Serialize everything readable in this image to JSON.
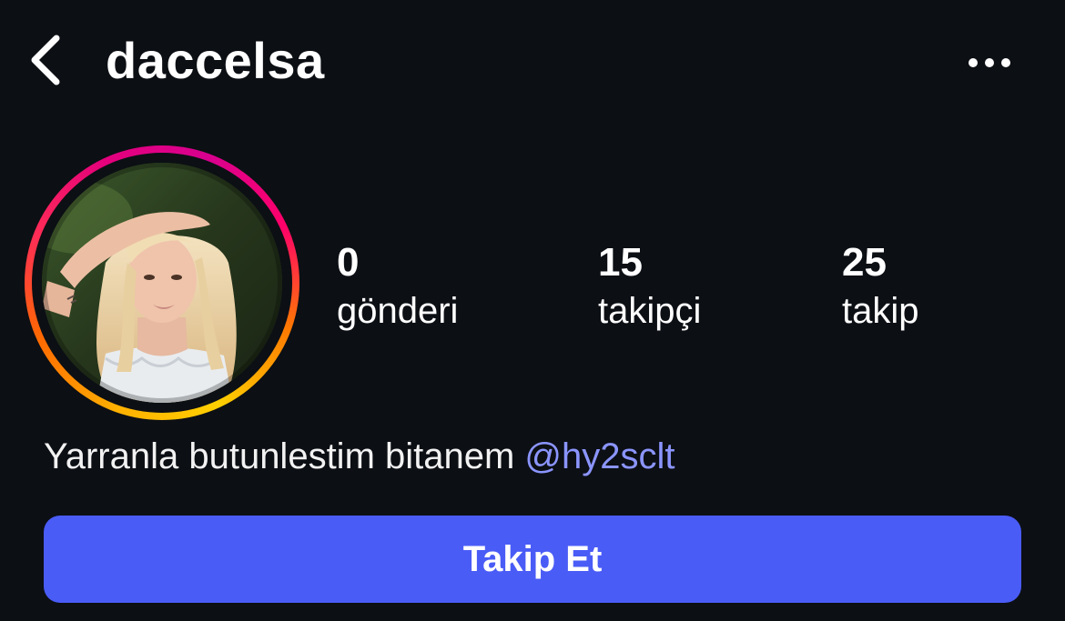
{
  "header": {
    "back_icon": "chevron-left-icon",
    "username": "daccelsa",
    "more_icon": "more-horizontal-icon"
  },
  "profile": {
    "avatar": {
      "has_story_ring": true,
      "ring_colors": [
        "#ffb000",
        "#ff6a00",
        "#ff2d55",
        "#e4007c",
        "#d8008f"
      ]
    },
    "stats": {
      "posts": {
        "value": "0",
        "label": "gönderi"
      },
      "followers": {
        "value": "15",
        "label": "takipçi"
      },
      "following": {
        "value": "25",
        "label": "takip"
      }
    },
    "bio": {
      "text": "Yarranla butunlestim bitanem ",
      "mention": "@hy2sclt"
    }
  },
  "actions": {
    "follow_label": "Takip Et"
  },
  "colors": {
    "background": "#0c0f14",
    "primary_button": "#4a5cf6",
    "mention": "#8b95ff",
    "text": "#ffffff"
  }
}
